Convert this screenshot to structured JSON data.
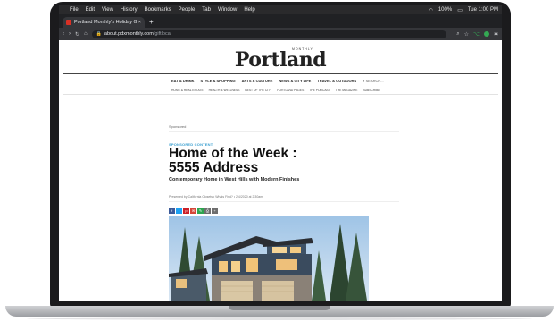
{
  "menubar": {
    "apple": "",
    "items": [
      "File",
      "Edit",
      "View",
      "History",
      "Bookmarks",
      "People",
      "Tab",
      "Window",
      "Help"
    ],
    "battery": "100%",
    "clock": "Tue 1:00 PM"
  },
  "browser": {
    "tab_title": "Portland Monthly's Holiday Gi",
    "tab_close": "×",
    "new_tab": "+",
    "back": "‹",
    "forward": "›",
    "reload": "↻",
    "home": "⌂",
    "url_host": "about.pdxmonthly.com",
    "url_path": "/giftlocal",
    "zoom_icon": "search-icon",
    "star": "☆"
  },
  "site": {
    "logo_small": "MONTHLY",
    "logo": "Portland",
    "nav_primary": [
      "EAT & DRINK",
      "STYLE & SHOPPING",
      "ARTS & CULTURE",
      "NEWS & CITY LIFE",
      "TRAVEL & OUTDOORS"
    ],
    "search_label": "⌕ SEARCH...",
    "nav_secondary": [
      "HOME & REAL ESTATE",
      "HEALTH & WELLNESS",
      "BEST OF THE CITY",
      "PORTLAND PAGES",
      "THE PODCAST",
      "THE MAGAZINE",
      "SUBSCRIBE"
    ],
    "sponsored": "Sponsored",
    "kicker": "SPONSORED CONTENT",
    "headline_line1": "Home of the Week :",
    "headline_line2": "5555 Address",
    "dek": "Contemporary Home in West Hills with Modern Finishes",
    "byline": "Presented by California Closets • Whats Find? • 2/4/2020 at 2:30am"
  },
  "share_colors": [
    "#3b5998",
    "#1da1f2",
    "#cb2027",
    "#d44638",
    "#2ea44f",
    "#6e6e6e",
    "#6e6e6e"
  ]
}
